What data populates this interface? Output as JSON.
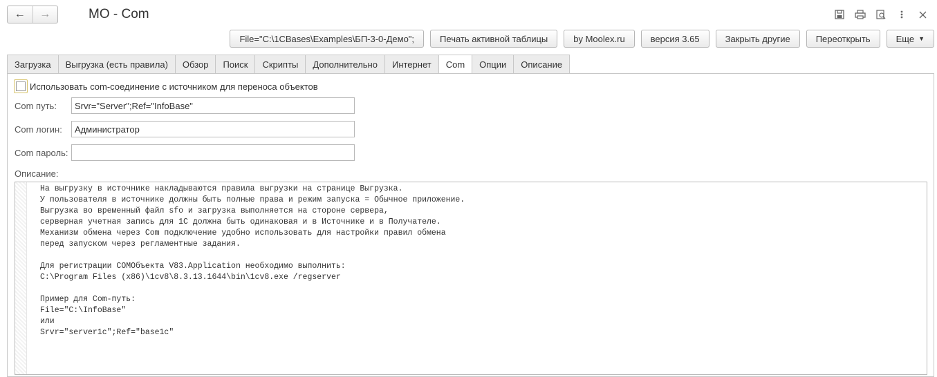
{
  "window": {
    "title": "МО - Com",
    "back_icon": "arrow-left-icon",
    "forward_icon": "arrow-right-icon",
    "icons": [
      "save-icon",
      "print-icon",
      "preview-icon",
      "more-icon",
      "close-icon"
    ]
  },
  "toolbar": {
    "buttons": [
      {
        "label": "File=\"C:\\1CBases\\Examples\\БП-3-0-Демо\";"
      },
      {
        "label": "Печать активной таблицы"
      },
      {
        "label": "by Moolex.ru"
      },
      {
        "label": "версия 3.65"
      },
      {
        "label": "Закрыть другие"
      },
      {
        "label": "Переоткрыть"
      },
      {
        "label": "Еще"
      }
    ]
  },
  "tabs": [
    {
      "label": "Загрузка"
    },
    {
      "label": "Выгрузка (есть правила)"
    },
    {
      "label": "Обзор"
    },
    {
      "label": "Поиск"
    },
    {
      "label": "Скрипты"
    },
    {
      "label": "Дополнительно"
    },
    {
      "label": "Интернет"
    },
    {
      "label": "Com",
      "active": true
    },
    {
      "label": "Опции"
    },
    {
      "label": "Описание"
    }
  ],
  "form": {
    "use_com_label": "Использовать com-соединение с источником для переноса объектов",
    "use_com_checked": false,
    "com_path_label": "Com путь:",
    "com_path_value": "Srvr=\"Server\";Ref=\"InfoBase\"",
    "com_login_label": "Com логин:",
    "com_login_value": "Администратор",
    "com_password_label": "Com пароль:",
    "com_password_value": "",
    "description_label": "Описание:",
    "description_text": "На выгрузку в источнике накладываются правила выгрузки на странице Выгрузка.\nУ пользователя в источнике должны быть полные права и режим запуска = Обычное приложение.\nВыгрузка во временный файл sfo и загрузка выполняется на стороне сервера,\nсерверная учетная запись для 1С должна быть одинаковая и в Источнике и в Получателе.\nМеханизм обмена через Com подключение удобно использовать для настройки правил обмена\nперед запуском через регламентные задания.\n\nДля регистрации COMОбъекта V83.Application необходимо выполнить:\nC:\\Program Files (x86)\\1cv8\\8.3.13.1644\\bin\\1cv8.exe /regserver\n\nПример для Com-путь:\nFile=\"C:\\InfoBase\"\nили\nSrvr=\"server1c\";Ref=\"base1c\""
  }
}
